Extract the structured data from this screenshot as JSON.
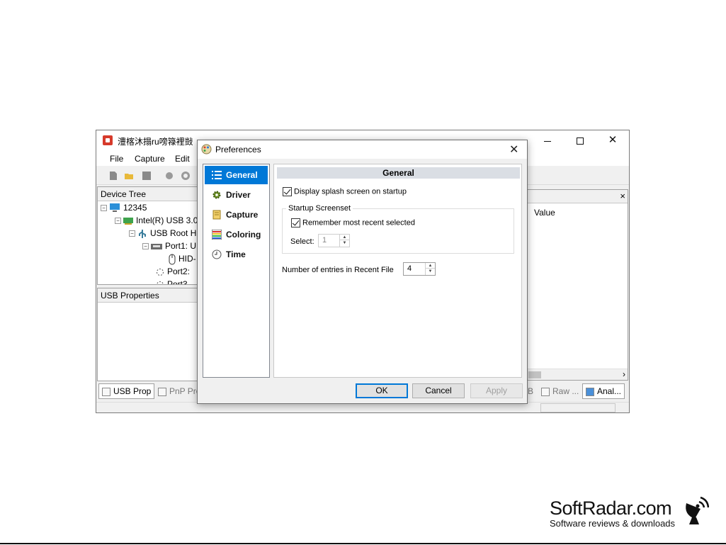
{
  "main_window": {
    "title": "澧楁沐搨ru嗙簶裡敱",
    "menu": [
      "File",
      "Capture",
      "Edit"
    ],
    "device_tree": {
      "header": "Device Tree",
      "items": [
        "12345",
        "Intel(R) USB 3.0",
        "USB Root H",
        "Port1: U",
        "HID-",
        "Port2:",
        "Port3"
      ]
    },
    "usb_properties_header": "USB Properties",
    "right_panel": {
      "column": "Value",
      "close": "×"
    },
    "bottom_tabs": [
      "USB Prop",
      "PnP Pro",
      "B",
      "Raw ...",
      "Anal..."
    ]
  },
  "dialog": {
    "title": "Preferences",
    "close": "✕",
    "nav": [
      {
        "label": "General",
        "icon": "list-icon",
        "active": true
      },
      {
        "label": "Driver",
        "icon": "gear-icon",
        "active": false
      },
      {
        "label": "Capture",
        "icon": "capture-icon",
        "active": false
      },
      {
        "label": "Coloring",
        "icon": "coloring-icon",
        "active": false
      },
      {
        "label": "Time",
        "icon": "clock-icon",
        "active": false
      }
    ],
    "section_title": "General",
    "splash_label": "Display splash screen on startup",
    "splash_checked": true,
    "startup_group": "Startup Screenset",
    "remember_label": "Remember most recent selected",
    "remember_checked": true,
    "select_label": "Select:",
    "select_value": "1",
    "recent_label": "Number of entries in Recent File",
    "recent_value": "4",
    "ok": "OK",
    "cancel": "Cancel",
    "apply": "Apply"
  },
  "watermark": {
    "name": "SoftRadar.com",
    "tagline": "Software reviews & downloads"
  },
  "colors": {
    "accent": "#0078d7",
    "section_header": "#dadee4"
  }
}
